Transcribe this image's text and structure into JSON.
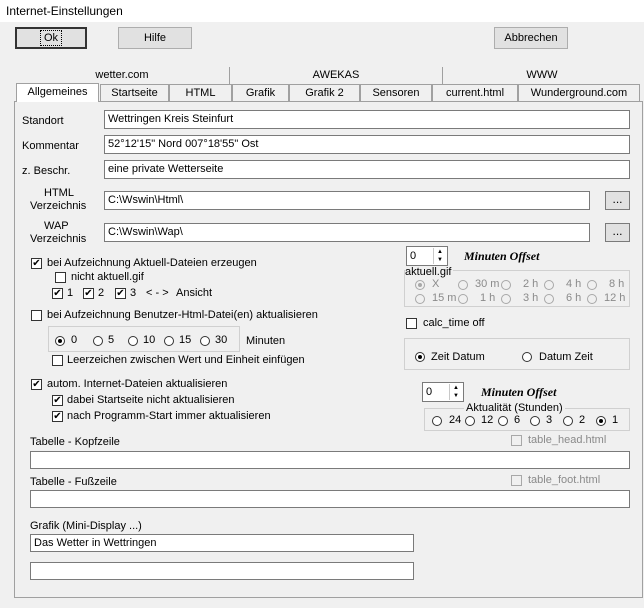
{
  "window": {
    "title": "Internet-Einstellungen"
  },
  "buttons": {
    "ok": "Ok",
    "hilfe": "Hilfe",
    "abbrechen": "Abbrechen"
  },
  "tabs_row1": [
    "wetter.com",
    "AWEKAS",
    "WWW"
  ],
  "tabs_row2": [
    "Allgemeines",
    "Startseite",
    "HTML",
    "Grafik",
    "Grafik 2",
    "Sensoren",
    "current.html",
    "Wunderground.com"
  ],
  "fields": {
    "standort": {
      "label": "Standort",
      "value": "Wettringen Kreis Steinfurt"
    },
    "kommentar": {
      "label": "Kommentar",
      "value": "52°12'15\" Nord  007°18'55\" Ost"
    },
    "beschr": {
      "label": "z. Beschr.",
      "value": "eine private Wetterseite"
    },
    "html_dir": {
      "label1": "HTML",
      "label2": "Verzeichnis",
      "value": "C:\\Wswin\\Html\\"
    },
    "wap_dir": {
      "label1": "WAP",
      "label2": "Verzeichnis",
      "value": "C:\\Wswin\\Wap\\"
    },
    "browse": "..."
  },
  "aktuell": {
    "main": "bei Aufzeichnung  Aktuell-Dateien erzeugen",
    "nicht_gif": "nicht aktuell.gif",
    "opt1": "1",
    "opt2": "2",
    "opt3": "3",
    "arrows": "< - >",
    "ansicht": "Ansicht"
  },
  "benutzer": {
    "main": "bei Aufzeichnung Benutzer-Html-Datei(en) aktualisieren",
    "minutes": [
      "0",
      "5",
      "10",
      "15",
      "30"
    ],
    "minuten": "Minuten",
    "leerzeichen": "Leerzeichen zwischen Wert und Einheit einfügen"
  },
  "internet": {
    "main": "autom. Internet-Dateien aktualisieren",
    "startseite": "dabei Startseite nicht aktualisieren",
    "nach_start": "nach Programm-Start immer aktualisieren"
  },
  "offset1": {
    "value": "0",
    "label": "Minuten Offset"
  },
  "gif_group": {
    "title": "aktuell.gif",
    "row1": [
      "X",
      "30 m",
      "2 h",
      "4 h",
      "8 h"
    ],
    "row2": [
      "15 m",
      "1 h",
      "3 h",
      "6 h",
      "12 h"
    ]
  },
  "calc_time": "calc_time off",
  "zeit": {
    "zeit_datum": "Zeit Datum",
    "datum_zeit": "Datum Zeit"
  },
  "offset2": {
    "value": "0",
    "label": "Minuten Offset"
  },
  "aktualitaet": {
    "title": "Aktualität  (Stunden)",
    "options": [
      "24",
      "12",
      "6",
      "3",
      "2",
      "1"
    ]
  },
  "kopfzeile": {
    "label": "Tabelle - Kopfzeile",
    "file": "table_head.html",
    "value": ""
  },
  "fusszeile": {
    "label": "Tabelle - Fußzeile",
    "file": "table_foot.html",
    "value": ""
  },
  "grafik": {
    "label": "Grafik (Mini-Display ...)",
    "value1": "Das Wetter in Wettringen",
    "value2": ""
  }
}
